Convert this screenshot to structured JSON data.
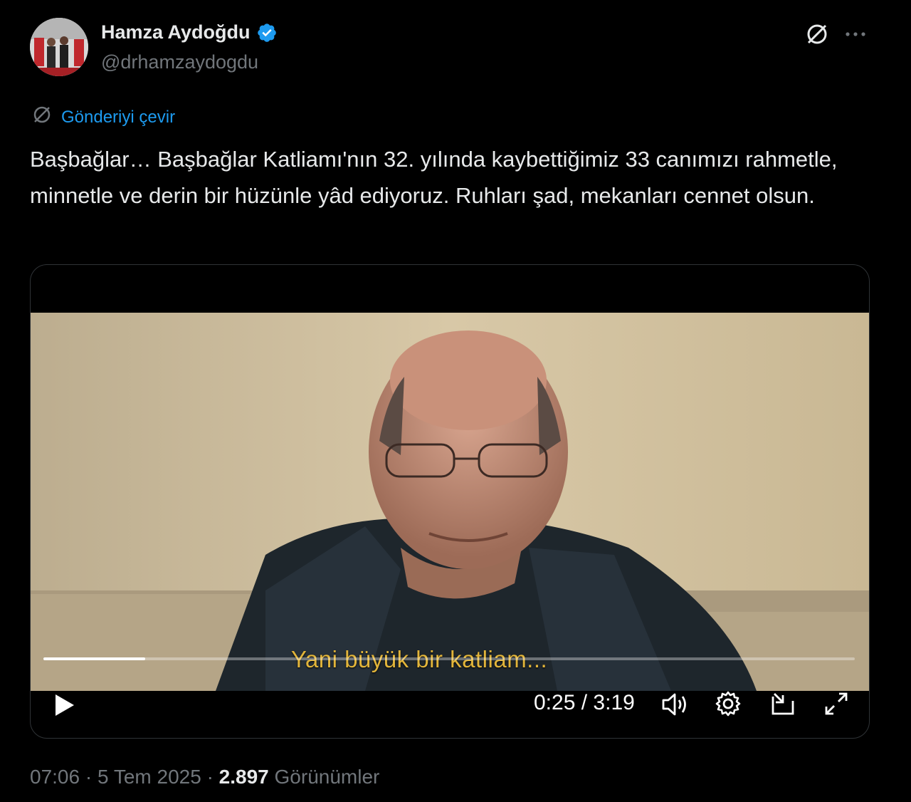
{
  "author": {
    "name": "Hamza Aydoğdu",
    "handle": "@drhamzaydogdu",
    "verified": true
  },
  "translate_label": "Gönderiyi çevir",
  "tweet": {
    "text": "Başbağlar… Başbağlar Katliamı'nın 32. yılında kaybettiğimiz 33 canımızı rahmetle, minnetle ve derin bir hüzünle yâd ediyoruz. Ruhları şad, mekanları cennet olsun."
  },
  "video": {
    "subtitle": "Yani büyük bir katliam...",
    "current_time": "0:25",
    "time_separator": "/",
    "duration": "3:19",
    "progress_fraction": 0.125
  },
  "meta": {
    "time": "07:06",
    "sep1": "·",
    "date": "5 Tem 2025",
    "sep2": "·",
    "views": "2.897",
    "views_label": "Görünümler"
  },
  "colors": {
    "accent": "#1d9bf0",
    "subtitle": "#e1b43a",
    "muted": "#71767b"
  },
  "icons": [
    "grok-icon",
    "more-icon",
    "verified-icon",
    "translate-icon",
    "play-icon",
    "volume-icon",
    "settings-icon",
    "pip-icon",
    "fullscreen-icon"
  ]
}
